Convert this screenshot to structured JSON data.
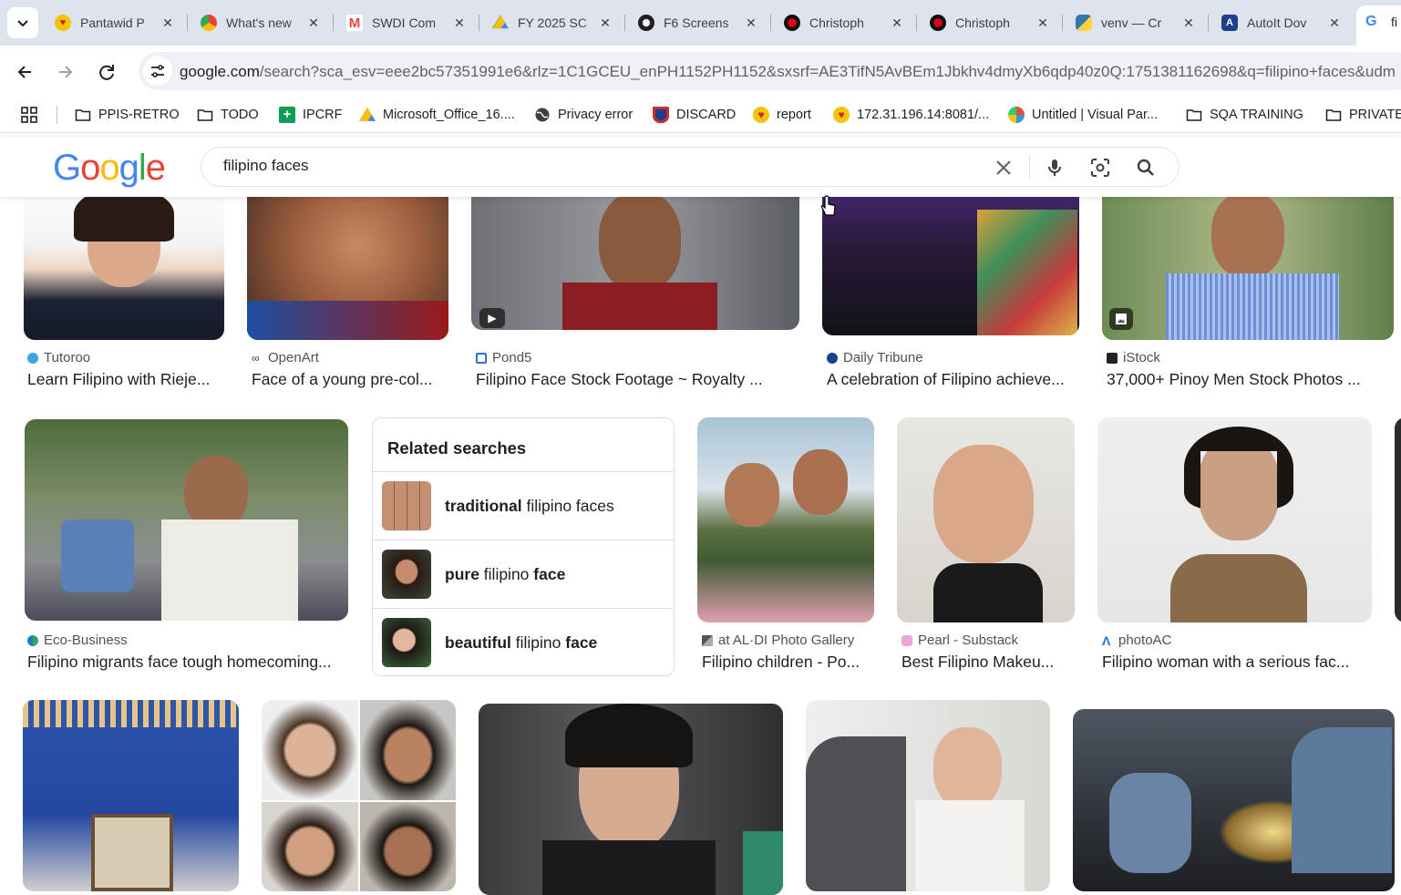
{
  "browser": {
    "tabs": [
      {
        "title": "Pantawid P",
        "icon": "heart-icon"
      },
      {
        "title": "What's new",
        "icon": "chrome-icon"
      },
      {
        "title": "SWDI Com",
        "icon": "gmail-icon"
      },
      {
        "title": "FY 2025 SC",
        "icon": "drive-icon"
      },
      {
        "title": "F6 Screens",
        "icon": "openai-icon"
      },
      {
        "title": "Christoph",
        "icon": "red-dot-icon"
      },
      {
        "title": "Christoph",
        "icon": "red-dot-icon"
      },
      {
        "title": "venv — Cr",
        "icon": "python-icon"
      },
      {
        "title": "AutoIt Dov",
        "icon": "autoit-icon"
      },
      {
        "title": "fi",
        "icon": "google-icon"
      }
    ],
    "url_host": "google.com",
    "url_rest": "/search?sca_esv=eee2bc57351991e6&rlz=1C1GCEU_enPH1152PH1152&sxsrf=AE3TifN5AvBEm1Jbkhv4dmyXb6qdp40z0Q:1751381162698&q=filipino+faces&udm",
    "bookmarks": [
      {
        "label": "PPIS-RETRO",
        "icon": "folder-icon"
      },
      {
        "label": "TODO",
        "icon": "folder-icon"
      },
      {
        "label": "IPCRF",
        "icon": "plus-square-icon"
      },
      {
        "label": "Microsoft_Office_16....",
        "icon": "drive-icon"
      },
      {
        "label": "Privacy error",
        "icon": "globe-icon"
      },
      {
        "label": "DISCARD",
        "icon": "shield-icon"
      },
      {
        "label": "report",
        "icon": "heart-icon"
      },
      {
        "label": "172.31.196.14:8081/...",
        "icon": "heart-icon"
      },
      {
        "label": "Untitled | Visual Par...",
        "icon": "vp-icon"
      },
      {
        "label": "SQA TRAINING",
        "icon": "folder-icon"
      },
      {
        "label": "PRIVATE",
        "icon": "folder-icon"
      }
    ]
  },
  "search": {
    "logo": "Google",
    "query": "filipino faces"
  },
  "results_row1": [
    {
      "source": "Tutoroo",
      "title": "Learn Filipino with Rieje..."
    },
    {
      "source": "OpenArt",
      "title": "Face of a young pre-col..."
    },
    {
      "source": "Pond5",
      "title": "Filipino Face Stock Footage ~ Royalty ..."
    },
    {
      "source": "Daily Tribune",
      "title": "A celebration of Filipino achieve..."
    },
    {
      "source": "iStock",
      "title": "37,000+ Pinoy Men Stock Photos ..."
    }
  ],
  "results_row2": [
    {
      "source": "Eco-Business",
      "title": "Filipino migrants face tough homecoming..."
    },
    {
      "source": "at AL·DI Photo Gallery",
      "title": "Filipino children - Po..."
    },
    {
      "source": "Pearl - Substack",
      "title": "Best Filipino Makeu..."
    },
    {
      "source": "photoAC",
      "title": "Filipino woman with a serious fac..."
    }
  ],
  "related": {
    "heading": "Related searches",
    "items": [
      {
        "bold1": "traditional",
        "normal": " filipino faces",
        "bold2": ""
      },
      {
        "bold1": "pure",
        "normal": " filipino ",
        "bold2": "face"
      },
      {
        "bold1": "beautiful",
        "normal": " filipino ",
        "bold2": "face"
      }
    ]
  }
}
